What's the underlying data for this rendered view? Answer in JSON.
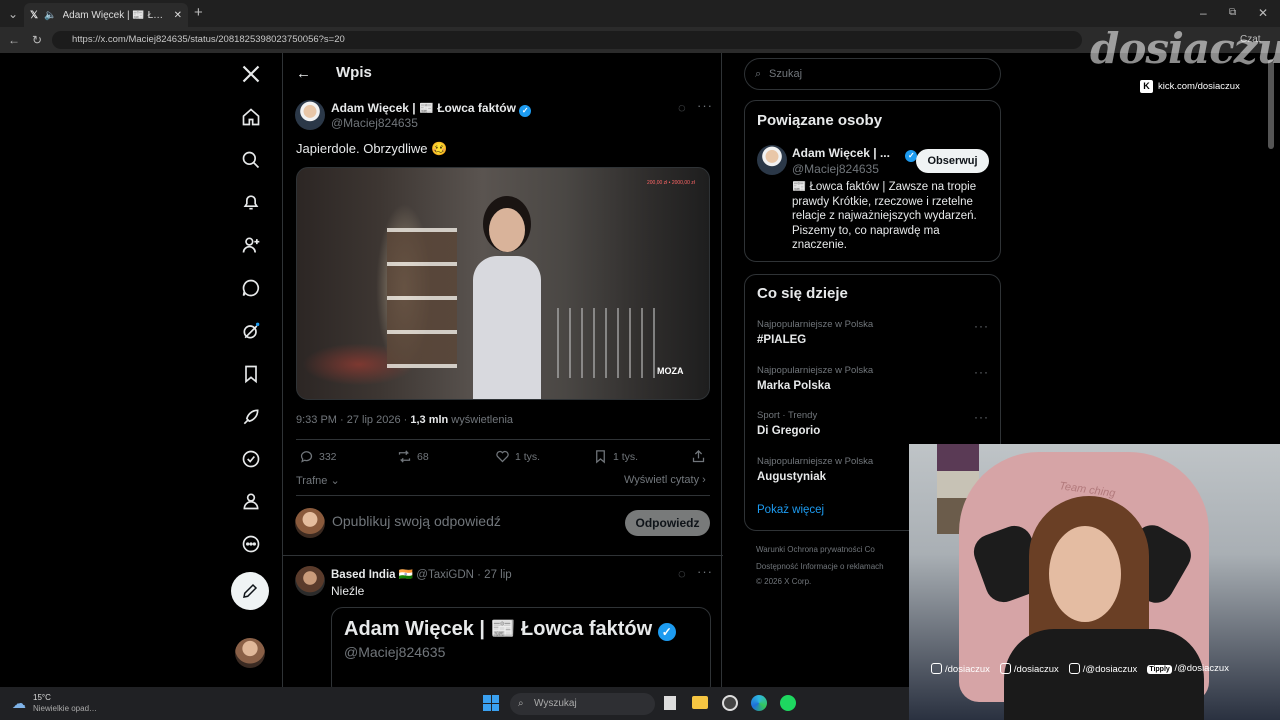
{
  "browser": {
    "tab_title": "Adam Więcek | 📰 Łowca fakt…",
    "url": "https://x.com/Maciej824635/status/2081825398023750056?s=20",
    "copilot_label": "Czat"
  },
  "nav": {
    "items": [
      "home-icon",
      "search-icon",
      "bell-icon",
      "add-person-icon",
      "message-icon",
      "grok-icon",
      "bookmark-icon",
      "rocket-icon",
      "verified-icon",
      "profile-icon",
      "more-icon"
    ]
  },
  "header": {
    "title": "Wpis"
  },
  "post": {
    "author_name": "Adam Więcek | 📰 Łowca faktów",
    "author_handle": "@Maciej824635",
    "text": "Japierdole. Obrzydliwe 🥴",
    "timestamp": "9:33 PM · 27 lip 2026 · ",
    "views_count": "1,3 mln",
    "views_label": " wyświetlenia",
    "replies": "332",
    "reposts": "68",
    "likes": "1 tys.",
    "bookmarks": "1 tys.",
    "sort_label": "Trafne",
    "quotes_link": "Wyświetl cytaty",
    "video_overlay_amount": "200,00 zł • 2000,00 zł",
    "video_brand": "MOZA"
  },
  "reply_box": {
    "placeholder": "Opublikuj swoją odpowiedź",
    "button": "Odpowiedz"
  },
  "reply": {
    "author_name": "Based India 🇮🇳",
    "author_handle": "@TaxiGDN",
    "time": "· 27 lip",
    "text": "Nieźle",
    "quote_name": "Adam Więcek | 📰 Łowca faktów",
    "quote_handle": "@Maciej824635"
  },
  "sidebar": {
    "search_placeholder": "Szukaj",
    "related_title": "Powiązane osoby",
    "related_name": "Adam Więcek | ...",
    "related_handle": "@Maciej824635",
    "related_bio": "📰 Łowca faktów | Zawsze na tropie prawdy Krótkie, rzeczowe i rzetelne relacje z najważniejszych wydarzeń. Piszemy to, co naprawdę ma znaczenie.",
    "follow_label": "Obserwuj",
    "trends_title": "Co się dzieje",
    "trends": [
      {
        "meta": "Najpopularniejsze w Polska",
        "topic": "#PIALEG"
      },
      {
        "meta": "Najpopularniejsze w Polska",
        "topic": "Marka Polska"
      },
      {
        "meta": "Sport · Trendy",
        "topic": "Di Gregorio"
      },
      {
        "meta": "Najpopularniejsze w Polska",
        "topic": "Augustyniak"
      }
    ],
    "show_more": "Pokaż więcej",
    "footer_line1": "Warunki     Ochrona prywatności     Co",
    "footer_line2": "Dostępność     Informacje o reklamach",
    "footer_line3": "© 2026 X Corp."
  },
  "overlay": {
    "logo_text": "dosiaczux",
    "kick_label": "kick.com/dosiaczux",
    "socials": [
      "/dosiaczux",
      "/dosiaczux",
      "/@dosiaczux",
      "/@dosiaczux"
    ],
    "tipply_label": "Tipply",
    "chair_text": "Team ching"
  },
  "taskbar": {
    "temperature": "15°C",
    "weather": "Niewielkie opad…",
    "search_label": "Wyszukaj"
  },
  "colors": {
    "accent": "#1d9bf0",
    "background": "#000000",
    "border": "#2f3336"
  }
}
